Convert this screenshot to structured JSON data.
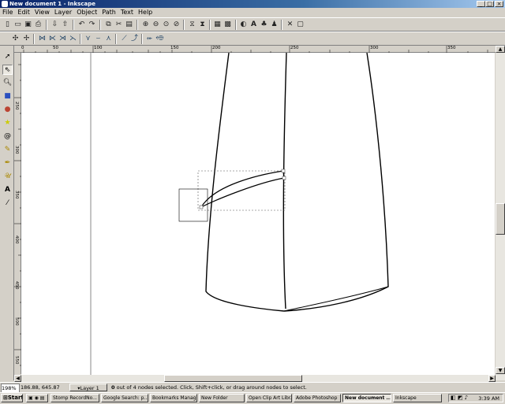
{
  "window": {
    "title": "New document 1 - Inkscape"
  },
  "menu": [
    "File",
    "Edit",
    "View",
    "Layer",
    "Object",
    "Path",
    "Text",
    "Help"
  ],
  "toolbar1_icons": [
    "new-icon",
    "open-icon",
    "save-icon",
    "print-icon",
    "import-icon",
    "export-icon",
    "undo-icon",
    "redo-icon",
    "copy-icon",
    "cut-icon",
    "paste-icon",
    "zoom-selection-icon",
    "zoom-drawing-icon",
    "zoom-page-icon",
    "zoom-width-icon",
    "duplicate-icon",
    "clone-icon",
    "unlink-clone-icon",
    "group-icon",
    "ungroup-icon",
    "fill-stroke-icon",
    "text-font-icon",
    "xml-editor-icon",
    "align-icon",
    "preferences-icon",
    "document-properties-icon"
  ],
  "toolbar2_icons": [
    "insert-node-icon",
    "delete-node-icon",
    "join-nodes-icon",
    "break-path-icon",
    "join-segment-icon",
    "delete-segment-icon",
    "cusp-node-icon",
    "smooth-node-icon",
    "symmetric-node-icon",
    "line-segment-icon",
    "curve-segment-icon",
    "object-to-path-icon",
    "stroke-to-path-icon"
  ],
  "tools": [
    "selector-tool",
    "node-tool",
    "zoom-tool",
    "rectangle-tool",
    "ellipse-tool",
    "star-tool",
    "spiral-tool",
    "pencil-tool",
    "pen-tool",
    "calligraphy-tool",
    "text-tool",
    "dropper-tool"
  ],
  "ruler_h": [
    "0",
    "50",
    "100",
    "150",
    "200",
    "250",
    "300",
    "350"
  ],
  "ruler_v": [
    "250",
    "300",
    "350",
    "400",
    "450",
    "500",
    "550"
  ],
  "status": {
    "zoom": "198%",
    "coords": "186.88, 645.87",
    "layer": "Layer 1",
    "message_count": "0",
    "message": "out of 4 nodes selected. Click, Shift+click, or drag around nodes to select."
  },
  "taskbar": {
    "start": "Start",
    "tasks": [
      "Stomp RecordNo...",
      "Google Search: p...",
      "Bookmarks Manager",
      "New Folder",
      "Open Clip Art Libr...",
      "Adobe Photoshop",
      "New document ...",
      "Inkscape"
    ],
    "clock": "3:39 AM"
  },
  "colors": {
    "titlebar": "#0a246a",
    "canvas": "#ffffff",
    "chrome": "#d4d0c8"
  }
}
